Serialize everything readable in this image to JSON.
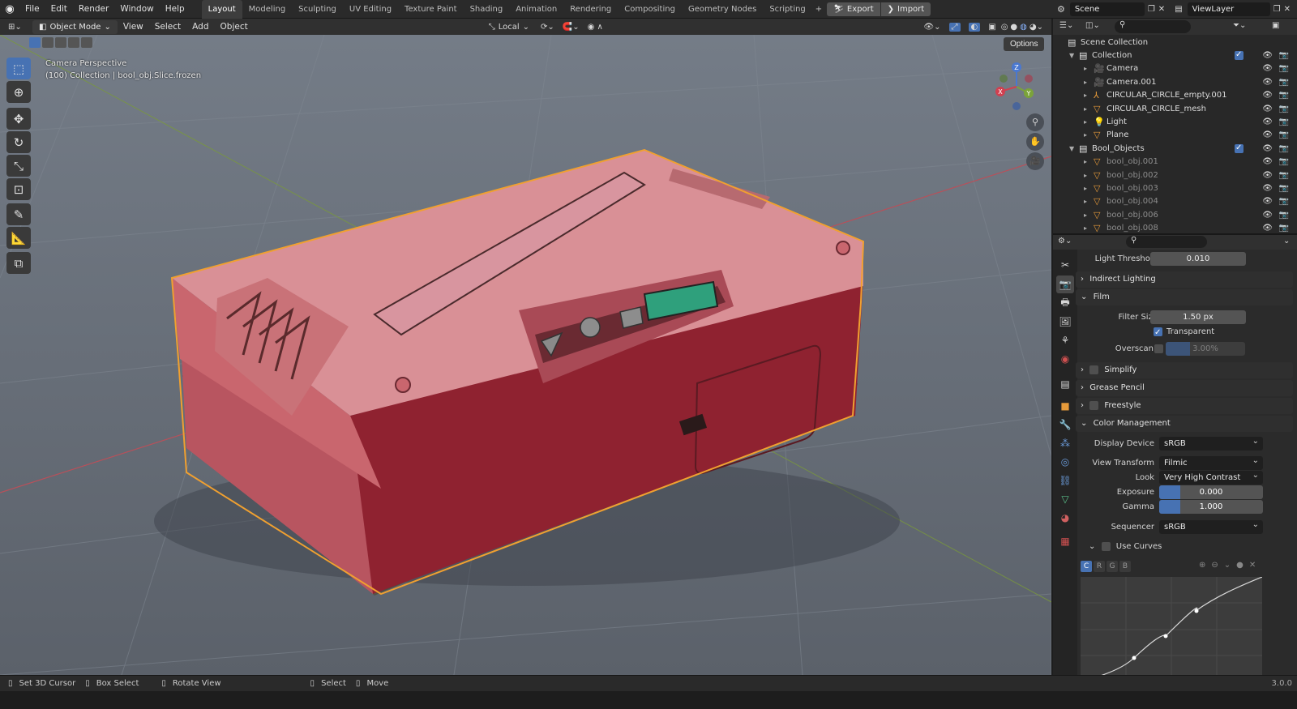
{
  "topbar": {
    "menus": [
      "File",
      "Edit",
      "Render",
      "Window",
      "Help"
    ],
    "workspaces": [
      "Layout",
      "Modeling",
      "Sculpting",
      "UV Editing",
      "Texture Paint",
      "Shading",
      "Animation",
      "Rendering",
      "Compositing",
      "Geometry Nodes",
      "Scripting"
    ],
    "active_workspace": "Layout",
    "add_label": "+",
    "export_label": "Export",
    "import_label": "Import",
    "scene_name": "Scene",
    "view_layer": "ViewLayer"
  },
  "viewport_header": {
    "mode": "Object Mode",
    "menus": [
      "View",
      "Select",
      "Add",
      "Object"
    ],
    "orientation": "Local",
    "options_label": "Options"
  },
  "viewport": {
    "overlay_line1": "Camera Perspective",
    "overlay_line2": "(100) Collection | bool_obj.Slice.frozen",
    "gizmo_axes": {
      "x": "X",
      "y": "Y",
      "z": "Z"
    }
  },
  "outliner": {
    "root": "Scene Collection",
    "rows": [
      {
        "label": "Collection",
        "icon": "collection-icon",
        "dim": false
      },
      {
        "label": "Camera",
        "icon": "camera-icon",
        "dim": false
      },
      {
        "label": "Camera.001",
        "icon": "camera-icon",
        "dim": false
      },
      {
        "label": "CIRCULAR_CIRCLE_empty.001",
        "icon": "empty-icon",
        "dim": false
      },
      {
        "label": "CIRCULAR_CIRCLE_mesh",
        "icon": "mesh-icon",
        "dim": false
      },
      {
        "label": "Light",
        "icon": "light-icon",
        "dim": false
      },
      {
        "label": "Plane",
        "icon": "mesh-icon",
        "dim": false
      },
      {
        "label": "Bool_Objects",
        "icon": "collection-icon",
        "dim": false
      },
      {
        "label": "bool_obj.001",
        "icon": "mesh-icon",
        "dim": true
      },
      {
        "label": "bool_obj.002",
        "icon": "mesh-icon",
        "dim": true
      },
      {
        "label": "bool_obj.003",
        "icon": "mesh-icon",
        "dim": true
      },
      {
        "label": "bool_obj.004",
        "icon": "mesh-icon",
        "dim": true
      },
      {
        "label": "bool_obj.006",
        "icon": "mesh-icon",
        "dim": true
      },
      {
        "label": "bool_obj.008",
        "icon": "mesh-icon",
        "dim": true
      }
    ]
  },
  "properties": {
    "light_threshold_label": "Light Threshold",
    "light_threshold_value": "0.010",
    "indirect_lighting": "Indirect Lighting",
    "film": "Film",
    "filter_size_label": "Filter Size",
    "filter_size_value": "1.50 px",
    "transparent_label": "Transparent",
    "overscan_label": "Overscan",
    "overscan_value": "3.00%",
    "simplify": "Simplify",
    "grease_pencil": "Grease Pencil",
    "freestyle": "Freestyle",
    "color_management": "Color Management",
    "display_device_label": "Display Device",
    "display_device_value": "sRGB",
    "view_transform_label": "View Transform",
    "view_transform_value": "Filmic",
    "look_label": "Look",
    "look_value": "Very High Contrast",
    "exposure_label": "Exposure",
    "exposure_value": "0.000",
    "exposure_fill": 0.2,
    "gamma_label": "Gamma",
    "gamma_value": "1.000",
    "gamma_fill": 0.2,
    "sequencer_label": "Sequencer",
    "sequencer_value": "sRGB",
    "use_curves_label": "Use Curves",
    "curve_channels": [
      "C",
      "R",
      "G",
      "B"
    ]
  },
  "statusbar": {
    "items": [
      "Set 3D Cursor",
      "Box Select",
      "Rotate View",
      "Select",
      "Move"
    ],
    "version": "3.0.0"
  },
  "colors": {
    "accent": "#4772b3",
    "selection_outline": "#f0a030",
    "box_top": "#d98a8e",
    "box_side": "#9a2a35",
    "screen_green": "#2fa07c"
  }
}
